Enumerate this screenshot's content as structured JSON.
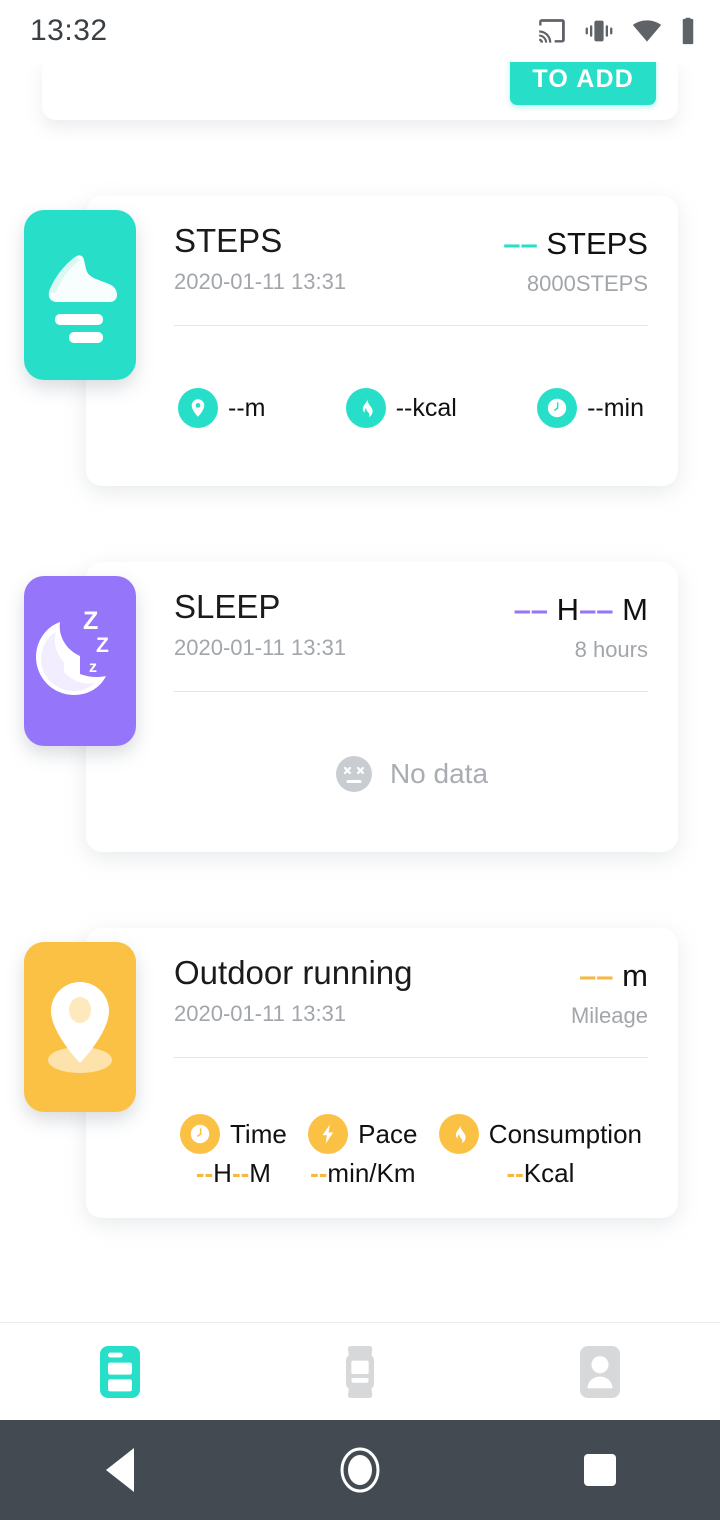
{
  "status_bar": {
    "time": "13:32",
    "icons": [
      "cast-icon",
      "vibrate-icon",
      "wifi-icon",
      "battery-icon"
    ]
  },
  "top_partial_card": {
    "to_add_label": "TO ADD"
  },
  "colors": {
    "teal": "#27DFC9",
    "purple": "#9575FA",
    "orange": "#FBC145",
    "orange_dash": "#F5B841",
    "muted": "#a2a6ab",
    "navbar": "#434A52"
  },
  "cards": [
    {
      "id": "steps",
      "icon": "shoe-icon",
      "tile_color": "#27DFC9",
      "title": "STEPS",
      "date": "2020-01-11 13:31",
      "metric_dash": "––",
      "metric_unit": "STEPS",
      "metric_sub": "8000STEPS",
      "stats": [
        {
          "icon": "location-pin-icon",
          "value": "--m"
        },
        {
          "icon": "flame-icon",
          "value": "--kcal"
        },
        {
          "icon": "clock-icon",
          "value": "--min"
        }
      ]
    },
    {
      "id": "sleep",
      "icon": "sleeping-moon-icon",
      "tile_color": "#9575FA",
      "title": "SLEEP",
      "date": "2020-01-11 13:31",
      "metric_dash": "––",
      "metric_unit_1": "H",
      "metric_unit_2": "M",
      "metric_sub": "8 hours",
      "no_data_icon": "dead-face-icon",
      "no_data_label": "No data"
    },
    {
      "id": "outdoor-running",
      "icon": "location-pin-icon",
      "tile_color": "#FBC145",
      "title": "Outdoor running",
      "date": "2020-01-11 13:31",
      "metric_dash": "––",
      "metric_unit": "m",
      "metric_sub": "Mileage",
      "stats": [
        {
          "icon": "clock-icon",
          "name": "Time",
          "dash": "--",
          "mid": "H",
          "dash2": "--",
          "unit": "M"
        },
        {
          "icon": "lightning-icon",
          "name": "Pace",
          "dash": "--",
          "unit": "min/Km"
        },
        {
          "icon": "flame-icon",
          "name": "Consumption",
          "dash": "--",
          "unit": "Kcal"
        }
      ]
    }
  ],
  "tab_bar": {
    "tabs": [
      {
        "name": "records-tab",
        "icon": "records-icon",
        "active": true
      },
      {
        "name": "device-tab",
        "icon": "watch-icon",
        "active": false
      },
      {
        "name": "profile-tab",
        "icon": "person-icon",
        "active": false
      }
    ]
  },
  "nav_bar": {
    "buttons": [
      {
        "name": "back-button",
        "icon": "triangle-back-icon"
      },
      {
        "name": "home-button",
        "icon": "circle-home-icon"
      },
      {
        "name": "recents-button",
        "icon": "square-recents-icon"
      }
    ]
  }
}
